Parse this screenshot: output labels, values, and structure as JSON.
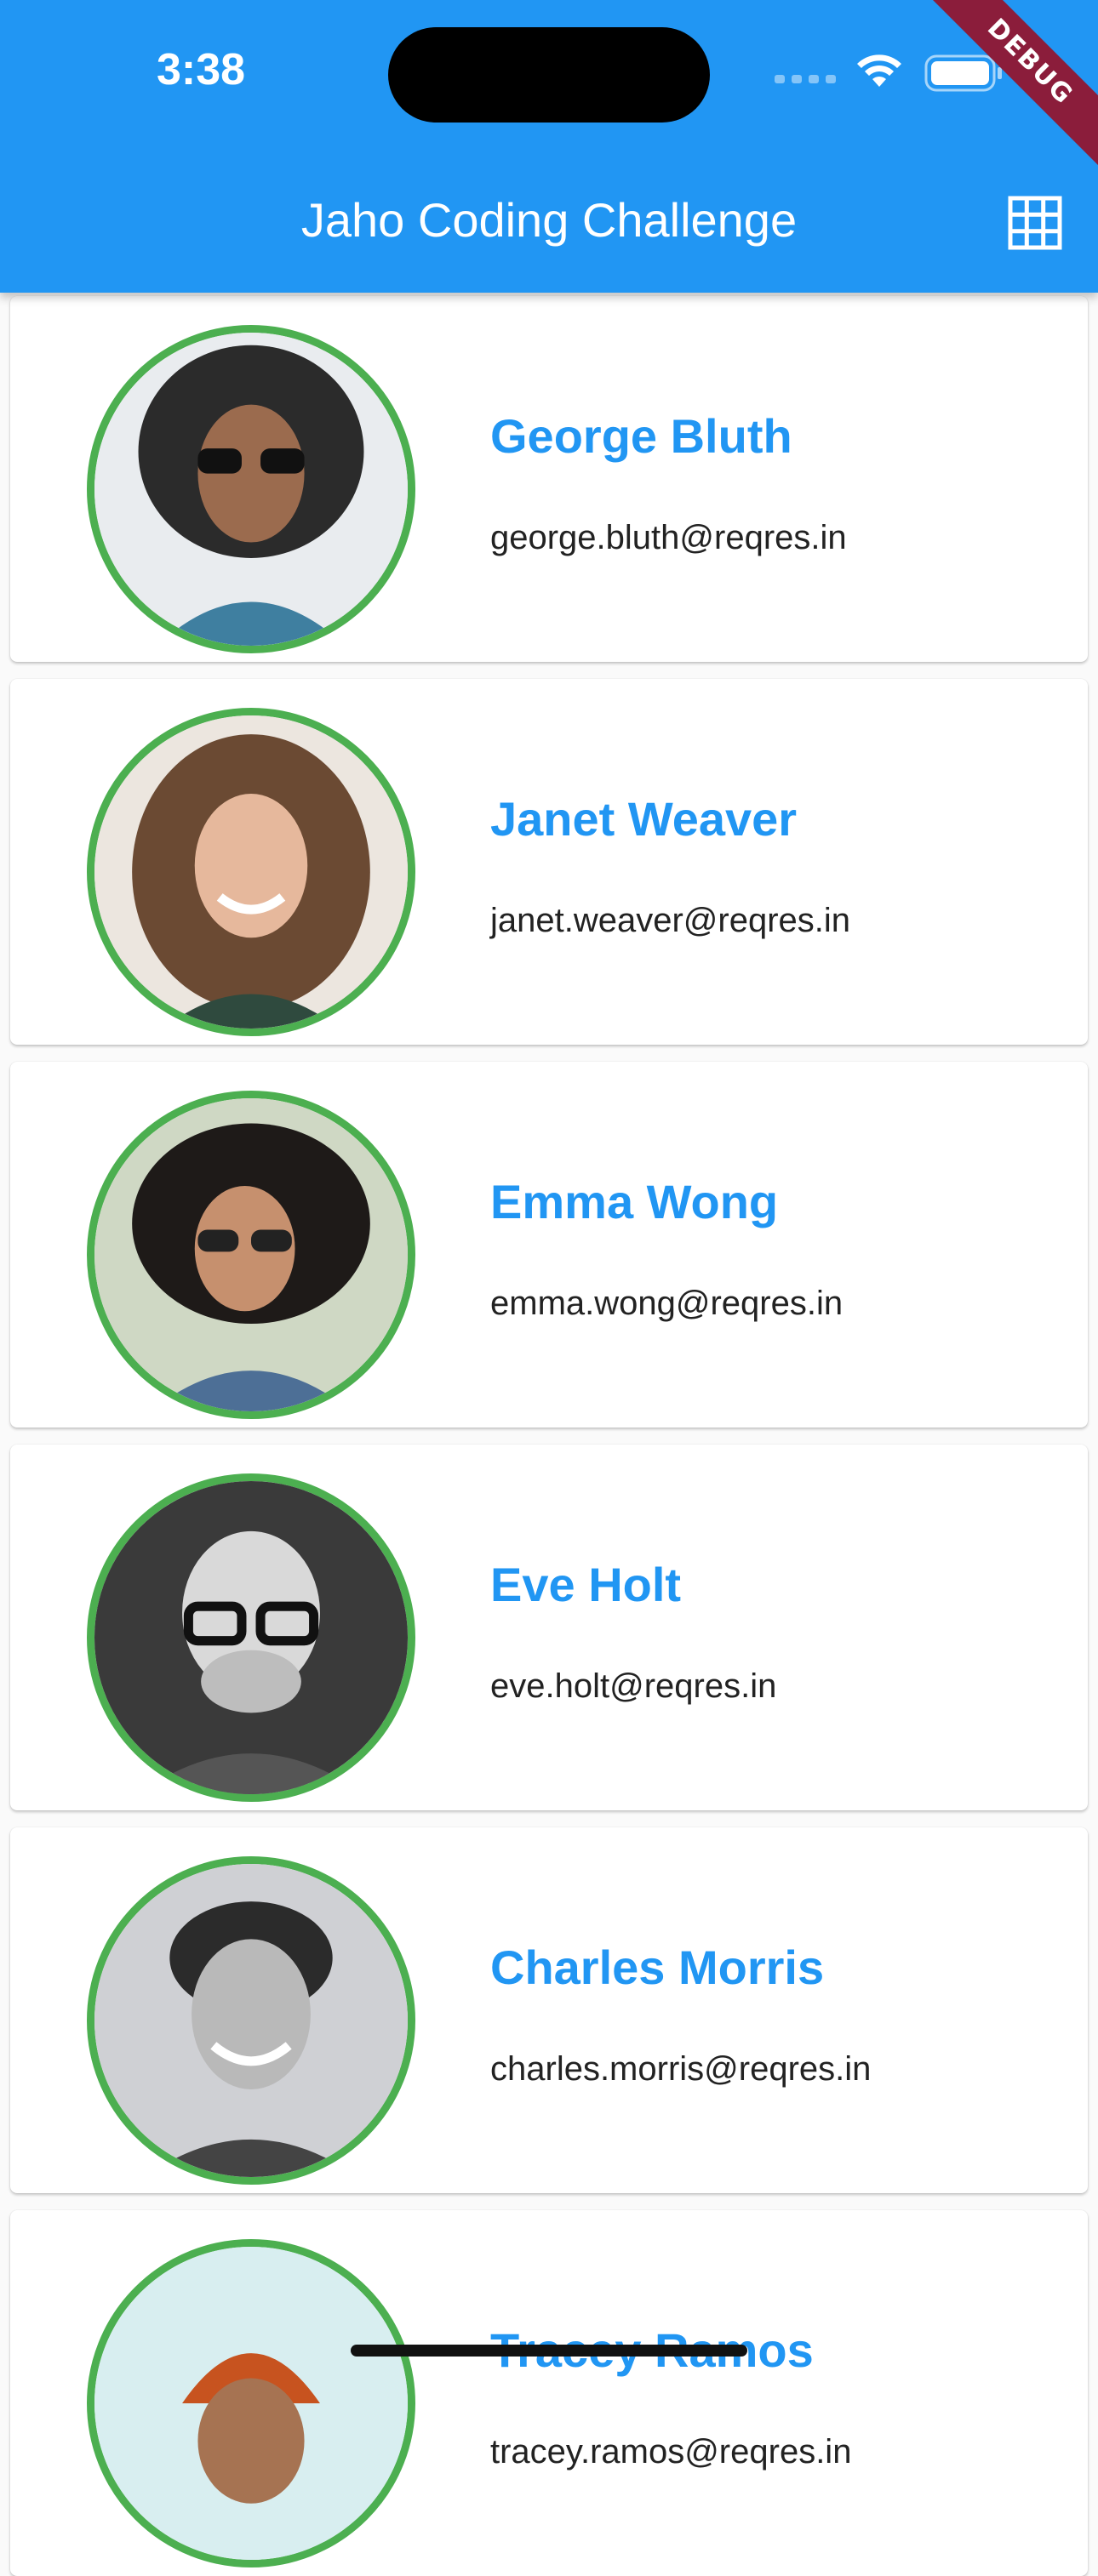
{
  "status_bar": {
    "time": "3:38"
  },
  "debug_banner": "DEBUG",
  "app_bar": {
    "title": "Jaho Coding Challenge",
    "action_icon": "grid-view-icon"
  },
  "colors": {
    "primary": "#2196f3",
    "avatar_border": "#4caf50",
    "name_text": "#2196f3",
    "debug_banner": "#8b1d3b"
  },
  "users": [
    {
      "name": "George Bluth",
      "email": "george.bluth@reqres.in"
    },
    {
      "name": "Janet Weaver",
      "email": "janet.weaver@reqres.in"
    },
    {
      "name": "Emma Wong",
      "email": "emma.wong@reqres.in"
    },
    {
      "name": "Eve Holt",
      "email": "eve.holt@reqres.in"
    },
    {
      "name": "Charles Morris",
      "email": "charles.morris@reqres.in"
    },
    {
      "name": "Tracey Ramos",
      "email": "tracey.ramos@reqres.in"
    }
  ]
}
